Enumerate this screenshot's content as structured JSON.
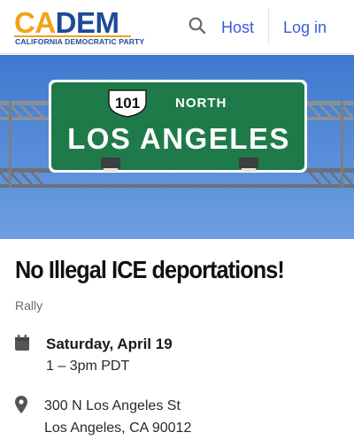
{
  "header": {
    "logo": {
      "ca": "CA",
      "dem": "DEM",
      "subtitle": "CALIFORNIA DEMOCRATIC PARTY"
    },
    "search_icon": "search-icon",
    "host_label": "Host",
    "login_label": "Log in"
  },
  "hero": {
    "route_number": "101",
    "direction": "NORTH",
    "destination": "LOS ANGELES"
  },
  "event": {
    "title": "No Illegal ICE deportations!",
    "type": "Rally",
    "date": "Saturday, April 19",
    "time": "1 – 3pm PDT",
    "address_line1": "300 N Los Angeles St",
    "address_line2": "Los Angeles, CA 90012",
    "date_icon": "calendar-icon",
    "location_icon": "map-pin-icon"
  },
  "colors": {
    "accent_link": "#3b5bdb",
    "brand_gold": "#f2a21a",
    "brand_blue": "#1d4b97",
    "sign_green": "#1f7a4a",
    "sky_blue": "#4a84d6"
  }
}
